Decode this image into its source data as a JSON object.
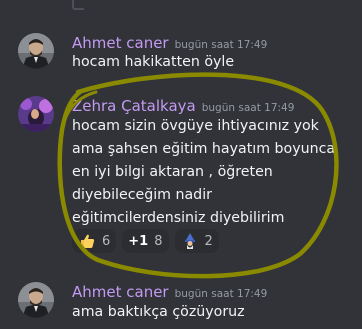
{
  "messages": [
    {
      "author": "Ahmet caner",
      "timestamp": "bugün saat 17:49",
      "lines": [
        "hocam hakikatten öyle"
      ],
      "avatar": "avatar-man-suit"
    },
    {
      "author": "Zehra Çatalkaya",
      "timestamp": "bugün saat 17:49",
      "lines": [
        "hocam sizin övgüye ihtiyacınız yok",
        "ama şahsen eğitim hayatım boyunca",
        "en iyi bilgi aktaran , öğreten",
        "diyebileceğim nadir",
        "eğitimcilerdensiniz diyebilirim"
      ],
      "avatar": "avatar-purple-photo",
      "reactions": [
        {
          "emoji": "thumbs-up-icon",
          "glyph": "👍",
          "count": "6"
        },
        {
          "emoji": "plus-one-icon",
          "glyph": "+1",
          "count": "8"
        },
        {
          "emoji": "wizard-icon",
          "glyph": "🧙",
          "count": "2"
        }
      ]
    },
    {
      "author": "Ahmet caner",
      "timestamp": "bugün saat 17:49",
      "lines": [
        "ama baktıkça çözüyoruz"
      ],
      "avatar": "avatar-man-suit"
    }
  ],
  "colors": {
    "background": "#313338",
    "author": "#c39af2",
    "timestamp": "#949ba4",
    "text": "#f2f3f5",
    "reaction_bg": "#2b2d31",
    "highlight_ellipse": "#8a8a00"
  }
}
